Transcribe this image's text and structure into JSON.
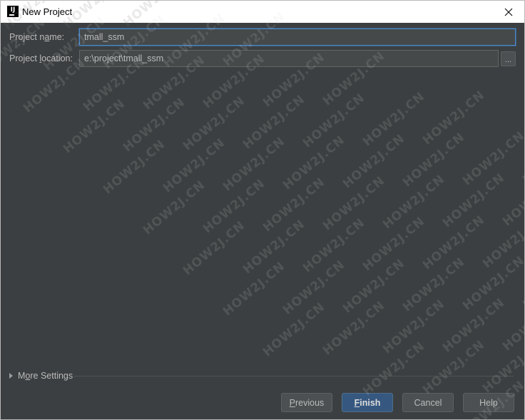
{
  "window": {
    "title": "New Project",
    "app_icon_text": "IJ",
    "close_icon": "close-icon"
  },
  "form": {
    "name_label_pre": "Project n",
    "name_label_mn": "a",
    "name_label_post": "me:",
    "name_value": "tmall_ssm",
    "location_label_pre": "Project ",
    "location_label_mn": "l",
    "location_label_post": "ocation:",
    "location_value": "e:\\project\\tmall_ssm",
    "browse_label": "..."
  },
  "more_settings": {
    "label_pre": "M",
    "label_mn": "o",
    "label_post": "re Settings",
    "expanded": false
  },
  "buttons": {
    "previous_mn": "P",
    "previous_rest": "revious",
    "finish_mn": "F",
    "finish_rest": "inish",
    "cancel": "Cancel",
    "help": "Help"
  },
  "watermark": {
    "text": "HOW2J.CN"
  },
  "colors": {
    "dialog_bg": "#3c3f41",
    "input_bg": "#45494a",
    "focus_border": "#4a88c7",
    "default_button": "#365880",
    "text": "#bbbbbb"
  }
}
